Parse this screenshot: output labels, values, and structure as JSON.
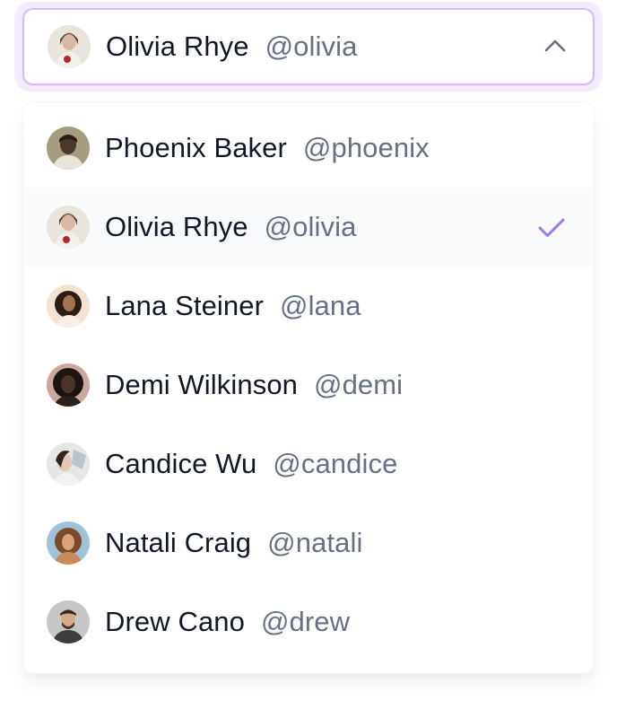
{
  "select": {
    "selected_name": "Olivia Rhye",
    "selected_handle": "@olivia",
    "expanded": true
  },
  "options": [
    {
      "name": "Phoenix Baker",
      "handle": "@phoenix",
      "selected": false
    },
    {
      "name": "Olivia Rhye",
      "handle": "@olivia",
      "selected": true
    },
    {
      "name": "Lana Steiner",
      "handle": "@lana",
      "selected": false
    },
    {
      "name": "Demi Wilkinson",
      "handle": "@demi",
      "selected": false
    },
    {
      "name": "Candice Wu",
      "handle": "@candice",
      "selected": false
    },
    {
      "name": "Natali Craig",
      "handle": "@natali",
      "selected": false
    },
    {
      "name": "Drew Cano",
      "handle": "@drew",
      "selected": false
    }
  ],
  "colors": {
    "accent": "#9e77ed",
    "border_focus": "#d6bbfb",
    "ring": "#f4ebff",
    "text_primary": "#101828",
    "text_secondary": "#667085",
    "selected_bg": "#f9fafb"
  },
  "icons": {
    "trigger_chevron": "chevron-up-icon",
    "selected_marker": "check-icon"
  }
}
